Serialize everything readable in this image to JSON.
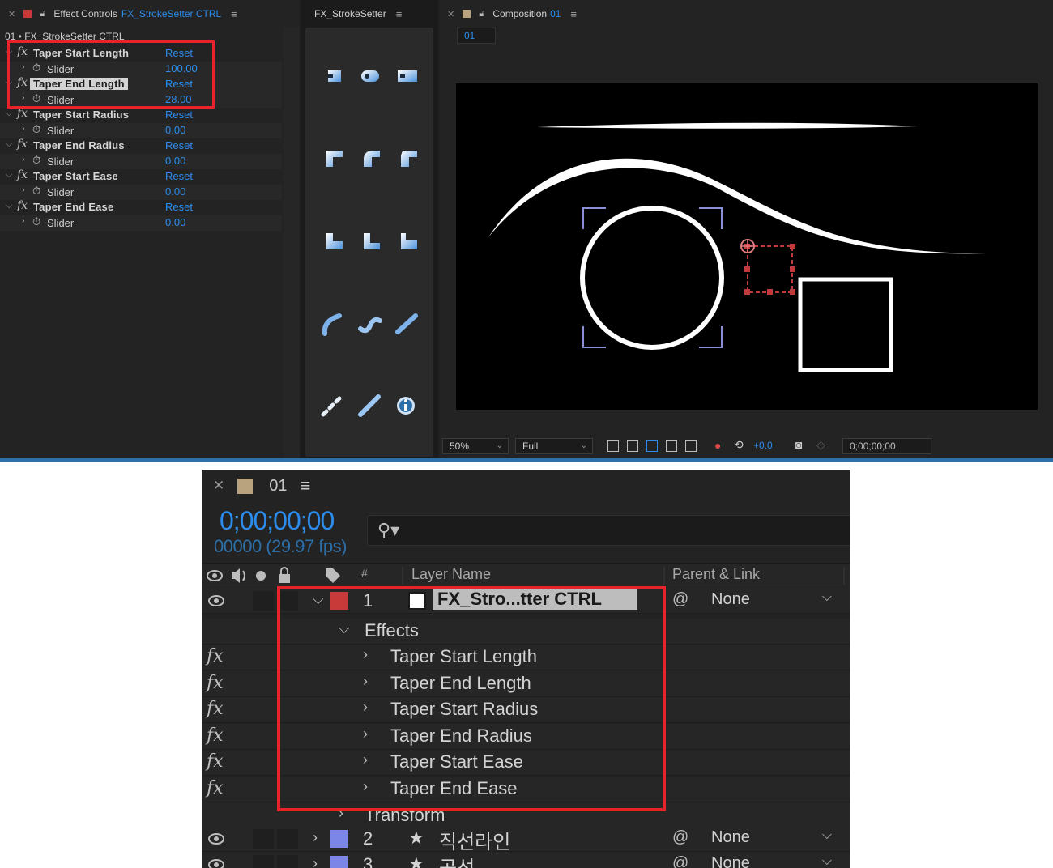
{
  "effect_controls": {
    "tab_prefix": "Effect Controls",
    "tab_target": "FX_StrokeSetter CTRL",
    "breadcrumb": "01 • FX_StrokeSetter CTRL",
    "effects": [
      {
        "name": "Taper Start Length",
        "reset": "Reset",
        "param": "Slider",
        "value": "100.00"
      },
      {
        "name": "Taper End Length",
        "reset": "Reset",
        "param": "Slider",
        "value": "28.00"
      },
      {
        "name": "Taper Start Radius",
        "reset": "Reset",
        "param": "Slider",
        "value": "0.00"
      },
      {
        "name": "Taper End Radius",
        "reset": "Reset",
        "param": "Slider",
        "value": "0.00"
      },
      {
        "name": "Taper Start Ease",
        "reset": "Reset",
        "param": "Slider",
        "value": "0.00"
      },
      {
        "name": "Taper End Ease",
        "reset": "Reset",
        "param": "Slider",
        "value": "0.00"
      }
    ]
  },
  "strokesetter": {
    "tab_title": "FX_StrokeSetter"
  },
  "composition": {
    "tab_prefix": "Composition",
    "tab_name": "01",
    "chip": "01",
    "zoom": "50%",
    "resolution": "Full",
    "exposure": "+0.0",
    "timecode": "0;00;00;00"
  },
  "timeline": {
    "comp_name": "01",
    "timecode": "0;00;00;00",
    "fps_line": "00000 (29.97 fps)",
    "headers": {
      "hash": "#",
      "layer_name": "Layer Name",
      "parent": "Parent & Link"
    },
    "layer1": {
      "index": "1",
      "name": "FX_Stro...tter CTRL",
      "parent": "None",
      "label_color": "#c8393a"
    },
    "effects_group": "Effects",
    "effect_items": [
      "Taper Start Length",
      "Taper End Length",
      "Taper Start Radius",
      "Taper End Radius",
      "Taper Start Ease",
      "Taper End Ease"
    ],
    "transform": "Transform",
    "layer2": {
      "index": "2",
      "name": "직선라인",
      "parent": "None",
      "label_color": "#7b86e6"
    },
    "layer3": {
      "index": "3",
      "name": "곡선",
      "parent": "None",
      "label_color": "#7b86e6"
    }
  },
  "colors": {
    "accent": "#2d8ceb",
    "highlight": "#e8232a"
  }
}
